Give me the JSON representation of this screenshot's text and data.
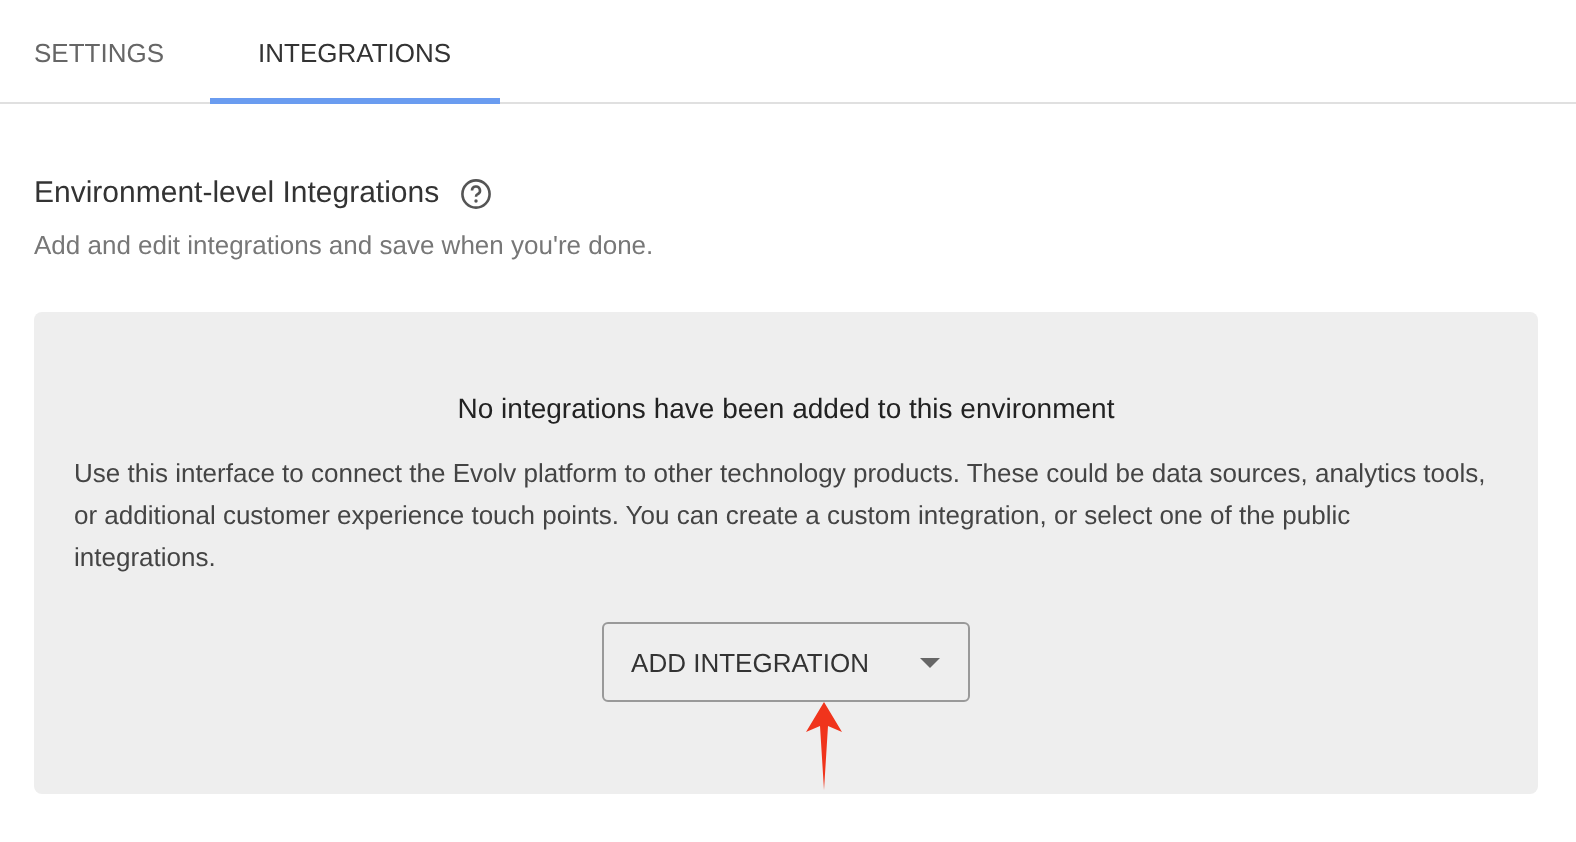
{
  "tabs": [
    {
      "label": "SETTINGS",
      "selected": false
    },
    {
      "label": "INTEGRATIONS",
      "selected": true
    }
  ],
  "section": {
    "title": "Environment-level Integrations",
    "subtitle": "Add and edit integrations and save when you're done."
  },
  "empty_state": {
    "title": "No integrations have been added to this environment",
    "description": "Use this interface to connect the Evolv platform to other technology products. These could be data sources, analytics tools, or additional customer experience touch points. You can create a custom integration, or select one of the public integrations.",
    "button": "ADD INTEGRATION"
  }
}
